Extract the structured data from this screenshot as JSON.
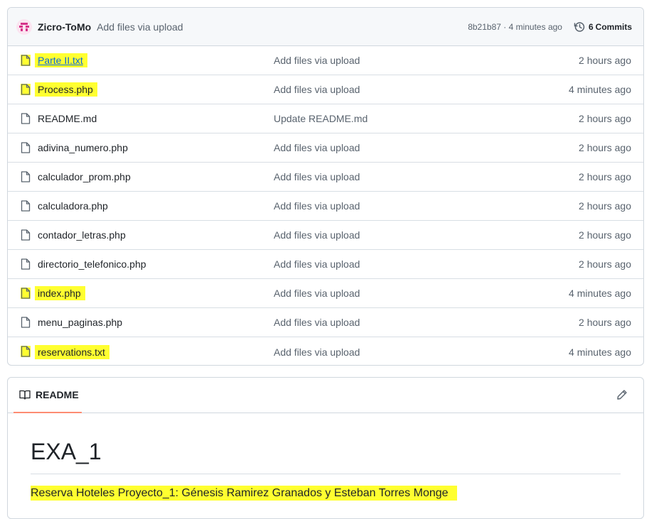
{
  "commit": {
    "author": "Zicro-ToMo",
    "message": "Add files via upload",
    "meta": "8b21b87 · 4 minutes ago",
    "commits_count": "6",
    "commits_label": "Commits"
  },
  "files": [
    {
      "name": "Parte II.txt",
      "message": "Add files via upload",
      "time": "2 hours ago",
      "highlighted": true,
      "linked": true
    },
    {
      "name": "Process.php",
      "message": "Add files via upload",
      "time": "4 minutes ago",
      "highlighted": true,
      "linked": false
    },
    {
      "name": "README.md",
      "message": "Update README.md",
      "time": "2 hours ago",
      "highlighted": false,
      "linked": false
    },
    {
      "name": "adivina_numero.php",
      "message": "Add files via upload",
      "time": "2 hours ago",
      "highlighted": false,
      "linked": false
    },
    {
      "name": "calculador_prom.php",
      "message": "Add files via upload",
      "time": "2 hours ago",
      "highlighted": false,
      "linked": false
    },
    {
      "name": "calculadora.php",
      "message": "Add files via upload",
      "time": "2 hours ago",
      "highlighted": false,
      "linked": false
    },
    {
      "name": "contador_letras.php",
      "message": "Add files via upload",
      "time": "2 hours ago",
      "highlighted": false,
      "linked": false
    },
    {
      "name": "directorio_telefonico.php",
      "message": "Add files via upload",
      "time": "2 hours ago",
      "highlighted": false,
      "linked": false
    },
    {
      "name": "index.php",
      "message": "Add files via upload",
      "time": "4 minutes ago",
      "highlighted": true,
      "linked": false
    },
    {
      "name": "menu_paginas.php",
      "message": "Add files via upload",
      "time": "2 hours ago",
      "highlighted": false,
      "linked": false
    },
    {
      "name": "reservations.txt",
      "message": "Add files via upload",
      "time": "4 minutes ago",
      "highlighted": true,
      "linked": false
    }
  ],
  "readme": {
    "tab_label": "README",
    "title": "EXA_1",
    "description": "Reserva Hoteles Proyecto_1: Génesis Ramirez Granados y Esteban Torres Monge"
  },
  "icons": {
    "file": "file-icon",
    "history": "history-icon",
    "book": "book-icon",
    "edit": "pencil-icon"
  },
  "colors": {
    "highlight": "#ffff30",
    "link": "#0969da",
    "tab_underline": "#fd8c73"
  }
}
